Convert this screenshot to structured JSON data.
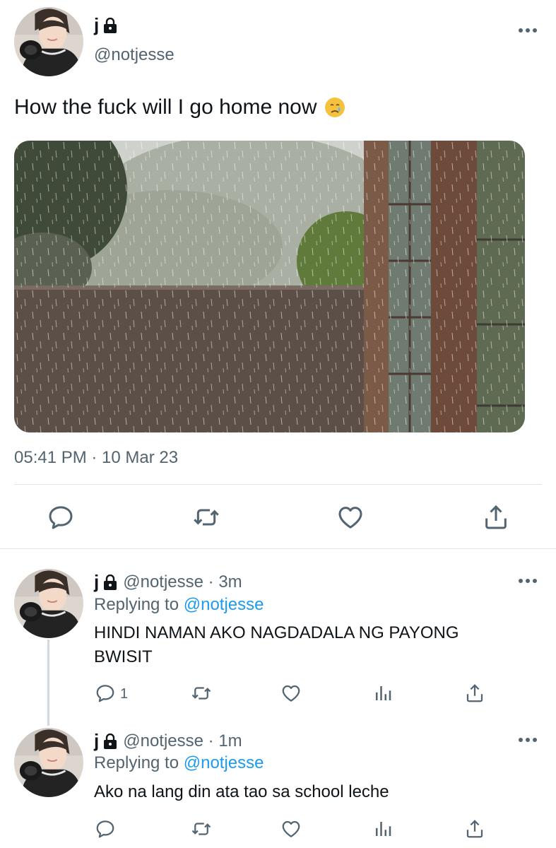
{
  "main_tweet": {
    "display_name": "j",
    "handle": "@notjesse",
    "text": "How the fuck will I go home now",
    "emoji": "crying-face-emoji",
    "timestamp": "05:41 PM · 10 Mar 23",
    "actions": [
      "reply-icon",
      "retweet-icon",
      "like-icon",
      "share-icon"
    ]
  },
  "replies": [
    {
      "display_name": "j",
      "handle": "@notjesse · 3m",
      "replying_label": "Replying to",
      "replying_to": "@notjesse",
      "text": "HINDI NAMAN AKO NAGDADALA NG PAYONG BWISIT",
      "reply_count": "1",
      "actions": [
        "reply-icon",
        "retweet-icon",
        "like-icon",
        "analytics-icon",
        "share-icon"
      ]
    },
    {
      "display_name": "j",
      "handle": "@notjesse · 1m",
      "replying_label": "Replying to",
      "replying_to": "@notjesse",
      "text": "Ako na lang din ata tao sa school leche",
      "actions": [
        "reply-icon",
        "retweet-icon",
        "like-icon",
        "analytics-icon",
        "share-icon"
      ]
    }
  ],
  "colors": {
    "text": "#0f1419",
    "secondary": "#536471",
    "link": "#1d9bf0",
    "divider": "#e1e5e8"
  }
}
